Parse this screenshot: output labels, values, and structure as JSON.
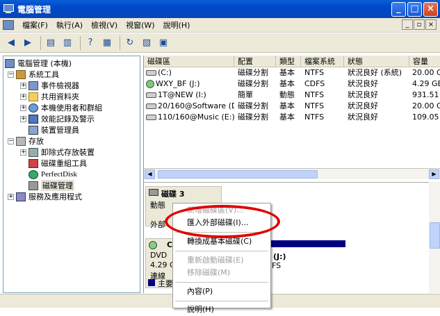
{
  "window": {
    "title": "電腦管理"
  },
  "menu": [
    "檔案(F)",
    "執行(A)",
    "檢視(V)",
    "視窗(W)",
    "說明(H)"
  ],
  "tree": {
    "root": "電腦管理 (本機)",
    "system_tools": "系統工具",
    "event_viewer": "事件檢視器",
    "shared_folders": "共用資料夾",
    "local_users": "本機使用者和群組",
    "perf_logs": "效能記錄及警示",
    "device_manager": "裝置管理員",
    "storage": "存放",
    "removable": "卸除式存放裝置",
    "defrag": "磁碟重組工具",
    "perfectdisk": "PerfectDisk",
    "disk_mgmt": "磁碟管理",
    "services": "服務及應用程式"
  },
  "columns": [
    "磁碟區",
    "配置",
    "類型",
    "檔案系統",
    "狀態",
    "容量"
  ],
  "volumes": [
    {
      "name": "(C:)",
      "layout": "磁碟分割",
      "type": "基本",
      "fs": "NTFS",
      "status": "狀況良好 (系統)",
      "cap": "20.00 G"
    },
    {
      "name": "WXY_BF (J:)",
      "layout": "磁碟分割",
      "type": "基本",
      "fs": "CDFS",
      "status": "狀況良好",
      "cap": "4.29 GE"
    },
    {
      "name": "1T@NEW (I:)",
      "layout": "簡單",
      "type": "動態",
      "fs": "NTFS",
      "status": "狀況良好",
      "cap": "931.51"
    },
    {
      "name": "20/160@Software (D:)",
      "layout": "磁碟分割",
      "type": "基本",
      "fs": "NTFS",
      "status": "狀況良好",
      "cap": "20.00 G"
    },
    {
      "name": "110/160@Music (E:)",
      "layout": "磁碟分割",
      "type": "基本",
      "fs": "NTFS",
      "status": "狀況良好",
      "cap": "109.05"
    }
  ],
  "graph": {
    "disk3_title": "磁碟 3",
    "disk3_type": "動態",
    "disk3_status": "外部",
    "cd_title": "C",
    "cd_type": "DVD",
    "cd_size": "4.29 G",
    "cd_status": "連線",
    "legend": "主要",
    "vol_label": "(J:)",
    "vol_fs": "FS"
  },
  "context_menu": {
    "new_volume": "新增磁碟區(V)...",
    "import": "匯入外部磁碟(I)...",
    "convert": "轉換成基本磁碟(C)",
    "reactivate": "重新啟動磁碟(E)",
    "remove": "移除磁碟(M)",
    "properties": "內容(P)",
    "help": "說明(H)"
  },
  "colors": {
    "titlebar": "#0a5fd6",
    "highlight": "#e00000",
    "primary_partition": "#000080"
  }
}
